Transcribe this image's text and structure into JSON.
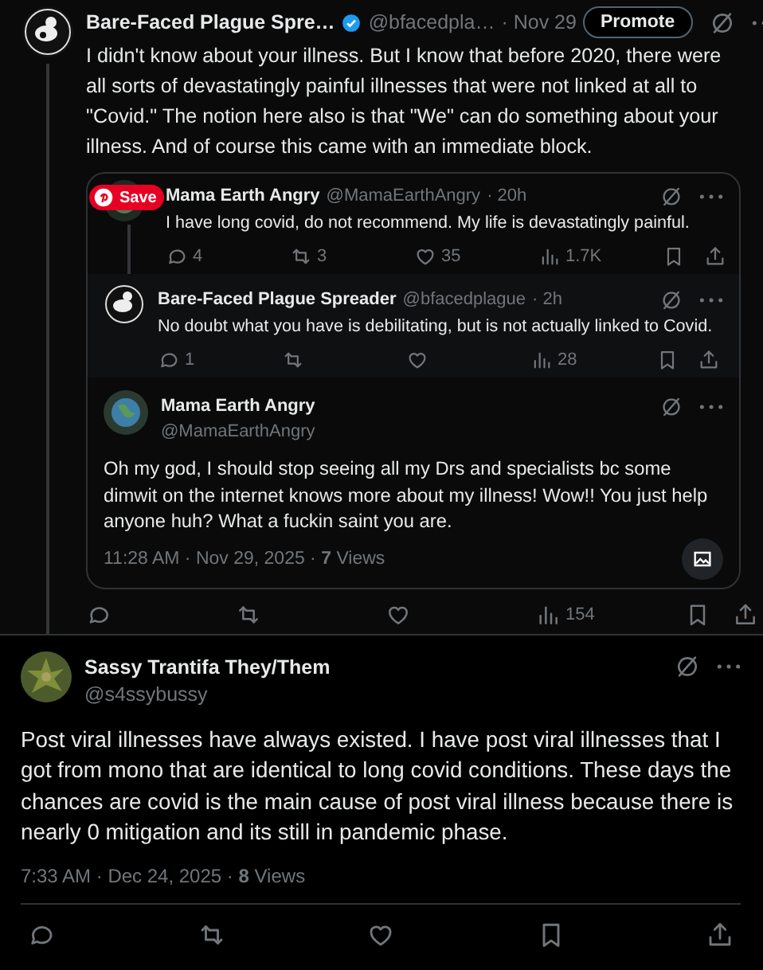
{
  "post": {
    "author": "Bare-Faced Plague Spre…",
    "verified": true,
    "handle": "@bfacedpla…",
    "time": "· Nov 29",
    "promote_button": "Promote",
    "text": "I didn't know about your illness. But I know that before 2020, there were all sorts of devastatingly painful illnesses that were not linked at all to \"Covid.\" The notion here also is that \"We\" can do something about your illness. And of course this came with an immediate block.",
    "actions": [
      {
        "kind": "reply"
      },
      {
        "kind": "repost"
      },
      {
        "kind": "like"
      },
      {
        "kind": "views",
        "count": "154"
      },
      {
        "kind": "bookmark"
      },
      {
        "kind": "share"
      }
    ]
  },
  "quote_card": {
    "quoted": {
      "author": "Mama Earth Angry",
      "handle": "@MamaEarthAngry",
      "time": "· 20h",
      "text": "I have long covid, do not recommend. My life is devastatingly painful.",
      "actions": [
        {
          "kind": "reply",
          "count": "4"
        },
        {
          "kind": "repost",
          "count": "3"
        },
        {
          "kind": "like",
          "count": "35"
        },
        {
          "kind": "views",
          "count": "1.7K"
        },
        {
          "kind": "bookmark"
        },
        {
          "kind": "share"
        }
      ]
    },
    "reply": {
      "author": "Bare-Faced Plague Spreader",
      "handle": "@bfacedplague",
      "time": "· 2h",
      "text": "No doubt what you have is debilitating, but is not actually linked to Covid.",
      "actions": [
        {
          "kind": "reply",
          "count": "1"
        },
        {
          "kind": "repost"
        },
        {
          "kind": "like"
        },
        {
          "kind": "views",
          "count": "28"
        },
        {
          "kind": "bookmark"
        },
        {
          "kind": "share"
        }
      ]
    },
    "focused": {
      "author": "Mama Earth Angry",
      "handle": "@MamaEarthAngry",
      "text": "Oh my god, I should stop seeing all my Drs and specialists bc some dimwit on the internet knows more about my illness! Wow!! You just help anyone huh? What a fuckin saint you are.",
      "timestamp": "11:28 AM · Nov 29, 2025 · **7** Views"
    }
  },
  "pinterest_save": "Save",
  "reply": {
    "author": "Sassy Trantifa They/Them",
    "handle": "@s4ssybussy",
    "text": "Post viral illnesses have always existed. I have post viral illnesses that I got from mono that are identical to long covid conditions. These days the chances are covid is the main cause of post viral illness because there is nearly 0 mitigation and its still in pandemic phase.",
    "timestamp": "7:33 AM · Dec 24, 2025 · **8** Views",
    "actions": [
      {
        "kind": "reply"
      },
      {
        "kind": "repost"
      },
      {
        "kind": "like"
      },
      {
        "kind": "bookmark"
      },
      {
        "kind": "share"
      }
    ]
  }
}
